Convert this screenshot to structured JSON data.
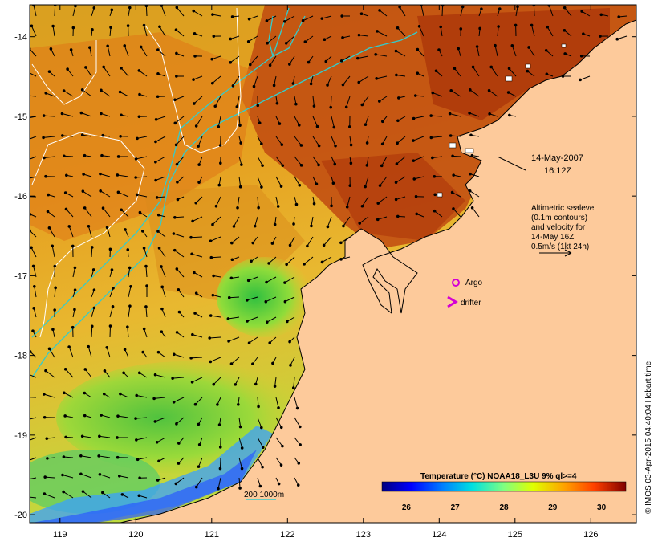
{
  "map": {
    "lon_range": [
      118.6,
      126.6
    ],
    "lat_range": [
      -20.1,
      -13.6
    ],
    "lon_ticks": [
      "119",
      "120",
      "121",
      "122",
      "123",
      "124",
      "125",
      "126"
    ],
    "lat_ticks": [
      "-14",
      "-15",
      "-16",
      "-17",
      "-18",
      "-19",
      "-20"
    ],
    "land_color": "#fdca9b"
  },
  "annotations": {
    "date": "14-May-2007",
    "time": "16:12Z",
    "altimetry_lines": [
      "Altimetric sealevel",
      "(0.1m contours)",
      "and velocity for",
      "14-May 16Z",
      "0.5m/s (1kt 24h)"
    ],
    "argo_label": "Argo",
    "drifter_label": "drifter",
    "bathy_legend": "200  1000m"
  },
  "colorbar": {
    "title": "Temperature (°C) NOAA18_L3U 9% ql>=4",
    "ticks": [
      "26",
      "27",
      "28",
      "29",
      "30"
    ],
    "range": [
      25.5,
      30.5
    ]
  },
  "credit": "© IMOS 03-Apr-2015 04:40:04 Hobart time",
  "colors": {
    "argo": "#d400d4",
    "drifter": "#d400d4",
    "isobath": "#33cccc"
  }
}
